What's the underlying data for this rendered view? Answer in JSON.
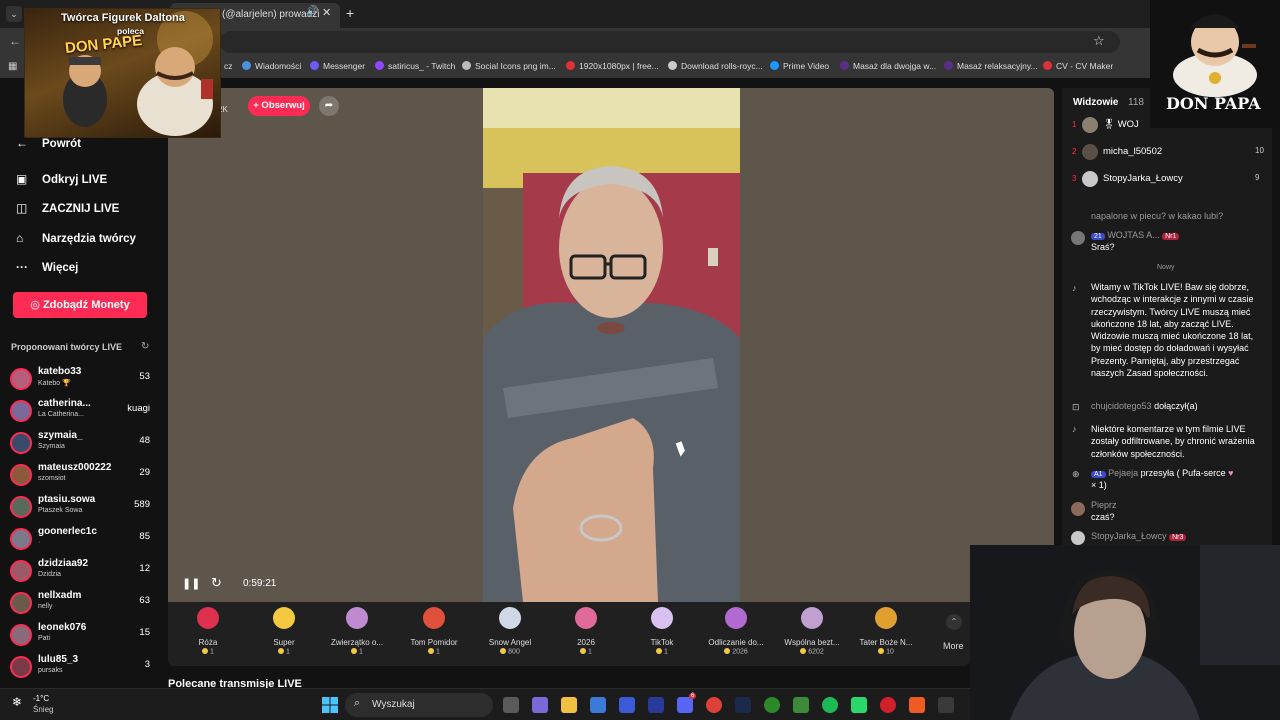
{
  "browser": {
    "tab_title": "(@alarjelen) prowadzi",
    "tab_close": "✕",
    "tab_audio": "🔊",
    "new_tab": "+",
    "bookmarks": [
      {
        "label": "Wiadomości",
        "color": "#4a90e2"
      },
      {
        "label": "Messenger",
        "color": "#6b5cf6"
      },
      {
        "label": "satiricus_ - Twitch",
        "color": "#9146ff"
      },
      {
        "label": "Social Icons png im...",
        "color": "#bbbbbb"
      },
      {
        "label": "1920x1080px | free...",
        "color": "#e0303a"
      },
      {
        "label": "Download rolls-royc...",
        "color": "#cccccc"
      },
      {
        "label": "Prime Video",
        "color": "#1a98ff"
      },
      {
        "label": "Masaż dla dwojga w...",
        "color": "#5a2d86"
      },
      {
        "label": "Masaż relaksacyjny...",
        "color": "#5a2d86"
      },
      {
        "label": "CV - CV Maker",
        "color": "#e0303a"
      }
    ],
    "bookmark_partial": "cz"
  },
  "sidebar": {
    "back_label": "Powrót",
    "nav": [
      {
        "label": "Odkryj LIVE",
        "icon": "calendar-icon"
      },
      {
        "label": "ZACZNIJ LIVE",
        "icon": "camera-icon"
      },
      {
        "label": "Narzędzia twórcy",
        "icon": "lightbulb-icon"
      },
      {
        "label": "Więcej",
        "icon": "more-icon"
      }
    ],
    "coins_label": "Zdobądź Monety",
    "suggested_heading": "Proponowani twórcy LIVE",
    "creators": [
      {
        "name": "katebo33",
        "sub": "Katebo 🏆",
        "count": "53",
        "color": "#b4607a"
      },
      {
        "name": "catherina...",
        "sub": "La Catherina...",
        "count": "kuagi",
        "color": "#7a6a9a"
      },
      {
        "name": "szymaia_",
        "sub": "Szymaia",
        "count": "48",
        "color": "#3a4a6a"
      },
      {
        "name": "mateusz000222",
        "sub": "szomsiot",
        "count": "29",
        "color": "#8a5a3a"
      },
      {
        "name": "ptasiu.sowa",
        "sub": "Ptaszek Sowa",
        "count": "589",
        "color": "#5a6a5a"
      },
      {
        "name": "goonerlec1c",
        "sub": "·",
        "count": "85",
        "color": "#7a7a8a"
      },
      {
        "name": "dzidziaa92",
        "sub": "Dzidzia",
        "count": "12",
        "color": "#9a5a6a"
      },
      {
        "name": "nellxadm",
        "sub": "nelly",
        "count": "63",
        "color": "#6a5a4a"
      },
      {
        "name": "leonek076",
        "sub": "Pati",
        "count": "15",
        "color": "#8a6a7a"
      },
      {
        "name": "lulu85_3",
        "sub": "pursaks",
        "count": "3",
        "color": "#7a3a4a"
      }
    ]
  },
  "stream": {
    "follow_label": "+ Obserwuj",
    "share_icon": "➦",
    "viewers_small": "2K",
    "timer": "0:59:21"
  },
  "gifts": [
    {
      "name": "Róża",
      "price": "1",
      "color": "#e03050"
    },
    {
      "name": "Super",
      "price": "1",
      "color": "#f5c842"
    },
    {
      "name": "Zwierzątko o...",
      "price": "1",
      "color": "#c08ad0"
    },
    {
      "name": "Tom Pomidor",
      "price": "1",
      "color": "#e0503a"
    },
    {
      "name": "Snow Angel",
      "price": "800",
      "color": "#d0d8e8"
    },
    {
      "name": "2026",
      "price": "1",
      "color": "#e06a9a"
    },
    {
      "name": "TikTok",
      "price": "1",
      "color": "#d8c0f0"
    },
    {
      "name": "Odliczanie do...",
      "price": "2026",
      "color": "#b06ad0"
    },
    {
      "name": "Wspólna bezt...",
      "price": "6202",
      "color": "#c0a0d0"
    },
    {
      "name": "Tater Boże N...",
      "price": "10",
      "color": "#e0a030"
    }
  ],
  "more_label": "More",
  "recommended_heading": "Polecane transmisje LIVE",
  "chat": {
    "viewers_title": "Widzowie",
    "viewers_count": "118",
    "top_viewers": [
      {
        "rank": "1",
        "name": "WOJ",
        "score": ""
      },
      {
        "rank": "2",
        "name": "micha_l50502",
        "score": "10"
      },
      {
        "rank": "3",
        "name": "StopyJarka_Łowcy",
        "score": "9"
      }
    ],
    "prev_text": "napalone w piecu? w kakao lubi?",
    "msg1_badge": "21",
    "msg1_user": "WOJTAS A...",
    "msg1_rank": "Nr1",
    "msg1_text": "Sraś?",
    "new_label": "Nowy",
    "welcome": "Witamy w TikTok LIVE! Baw się dobrze, wchodząc w interakcje z innymi w czasie rzeczywistym. Twórcy LIVE muszą mieć ukończone 18 lat, aby zacząć LIVE. Widzowie muszą mieć ukończone 18 lat, by mieć dostęp do doładowań i wysyłać Prezenty. Pamiętaj, aby przestrzegać naszych Zasad społeczności.",
    "join_user": "chujcidotego53",
    "join_text": "dołączył(a)",
    "filter_note": "Niektóre komentarze w tym filmie LIVE zostały odfiltrowane, by chronić wrażenia członków społeczności.",
    "gift_badge": "A1",
    "gift_user": "Pejaeja",
    "gift_text": "przesyła ( Pufa-serce",
    "gift_count": "× 1)",
    "pieprz_user": "Pieprz",
    "pieprz_text": "czaś?",
    "last_user": "StopyJarka_Łowcy",
    "last_rank": "Nr3"
  },
  "promo": {
    "line1": "Twórca Figurek Daltona",
    "line2": "poleca",
    "line3": "DON PAPE"
  },
  "logo_text": "DON PAPA",
  "taskbar": {
    "temp": "-1°C",
    "weather": "Śnieg",
    "search": "Wyszukaj",
    "badge": "6"
  }
}
